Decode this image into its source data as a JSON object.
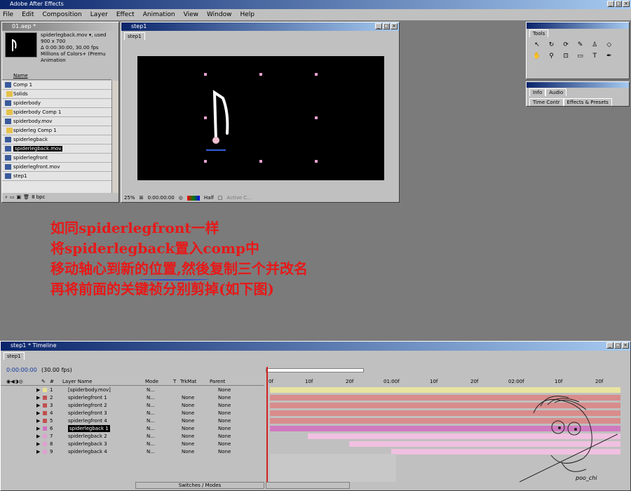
{
  "app": {
    "title": "Adobe After Effects"
  },
  "menu": [
    "File",
    "Edit",
    "Composition",
    "Layer",
    "Effect",
    "Animation",
    "View",
    "Window",
    "Help"
  ],
  "project": {
    "title": "01.aep *",
    "selected_info": [
      "spiderlegback.mov ▾, used",
      "900 x 700",
      "Δ 0:00:30:00, 30.00 fps",
      "Millions of Colors+ (Premu",
      "Animation"
    ],
    "col_name": "Name",
    "items": [
      {
        "name": "Comp 1",
        "type": "comp"
      },
      {
        "name": "Solids",
        "type": "folder"
      },
      {
        "name": "spiderbody",
        "type": "comp"
      },
      {
        "name": "spiderbody Comp 1",
        "type": "folder"
      },
      {
        "name": "spiderbody.mov",
        "type": "footage"
      },
      {
        "name": "spiderleg Comp 1",
        "type": "folder"
      },
      {
        "name": "spiderlegback",
        "type": "comp"
      },
      {
        "name": "spiderlegback.mov",
        "type": "footage",
        "selected": true
      },
      {
        "name": "spiderlegfront",
        "type": "comp"
      },
      {
        "name": "spiderlegfront.mov",
        "type": "footage"
      },
      {
        "name": "step1",
        "type": "comp"
      }
    ],
    "bpc": "8 bpc"
  },
  "comp": {
    "title": "step1",
    "tab": "step1",
    "zoom": "25%",
    "time": "0:00:00:00",
    "resolution": "Half",
    "camera": "Active C..."
  },
  "tools": {
    "title": "Tools"
  },
  "info": {
    "tabs": [
      "Info",
      "Audio"
    ],
    "tabs2": [
      "Time Contr",
      "Effects & Presets"
    ]
  },
  "overlay_text": [
    "如同spiderlegfront一样",
    "将spiderlegback置入comp中",
    "移动轴心到新的位置,然後复制三个并改名",
    "再将前面的关键祯分别剪掉(如下图)"
  ],
  "timeline": {
    "title": "step1 * Timeline",
    "tab": "step1",
    "time": "0:00:00:00",
    "fps": "(30.00 fps)",
    "headers": {
      "num": "#",
      "layer": "Layer Name",
      "mode": "Mode",
      "t": "T",
      "trkmat": "TrkMat",
      "parent": "Parent"
    },
    "ruler": [
      "0f",
      "10f",
      "20f",
      "01:00f",
      "10f",
      "20f",
      "02:00f",
      "10f",
      "20f"
    ],
    "layers": [
      {
        "num": "1",
        "name": "[spiderbody.mov]",
        "mode": "N...",
        "trkmat": "",
        "parent": "None",
        "color": "#e8e090"
      },
      {
        "num": "2",
        "name": "spiderlegfront 1",
        "mode": "N...",
        "trkmat": "None",
        "parent": "None",
        "color": "#c05050"
      },
      {
        "num": "3",
        "name": "spiderlegfront 2",
        "mode": "N...",
        "trkmat": "None",
        "parent": "None",
        "color": "#c05050"
      },
      {
        "num": "4",
        "name": "spiderlegfront 3",
        "mode": "N...",
        "trkmat": "None",
        "parent": "None",
        "color": "#c05050"
      },
      {
        "num": "5",
        "name": "spiderlegfront 4",
        "mode": "N...",
        "trkmat": "None",
        "parent": "None",
        "color": "#c05050"
      },
      {
        "num": "6",
        "name": "spiderlegback 1",
        "mode": "N...",
        "trkmat": "None",
        "parent": "None",
        "color": "#d070c0",
        "selected": true
      },
      {
        "num": "7",
        "name": "spiderlegback 2",
        "mode": "N...",
        "trkmat": "None",
        "parent": "None",
        "color": "#e0a0d0"
      },
      {
        "num": "8",
        "name": "spiderlegback 3",
        "mode": "N...",
        "trkmat": "None",
        "parent": "None",
        "color": "#e0a0d0"
      },
      {
        "num": "9",
        "name": "spiderlegback 4",
        "mode": "N...",
        "trkmat": "None",
        "parent": "None",
        "color": "#e0a0d0"
      }
    ],
    "switches_label": "Switches / Modes",
    "signature": "poo_chi"
  }
}
